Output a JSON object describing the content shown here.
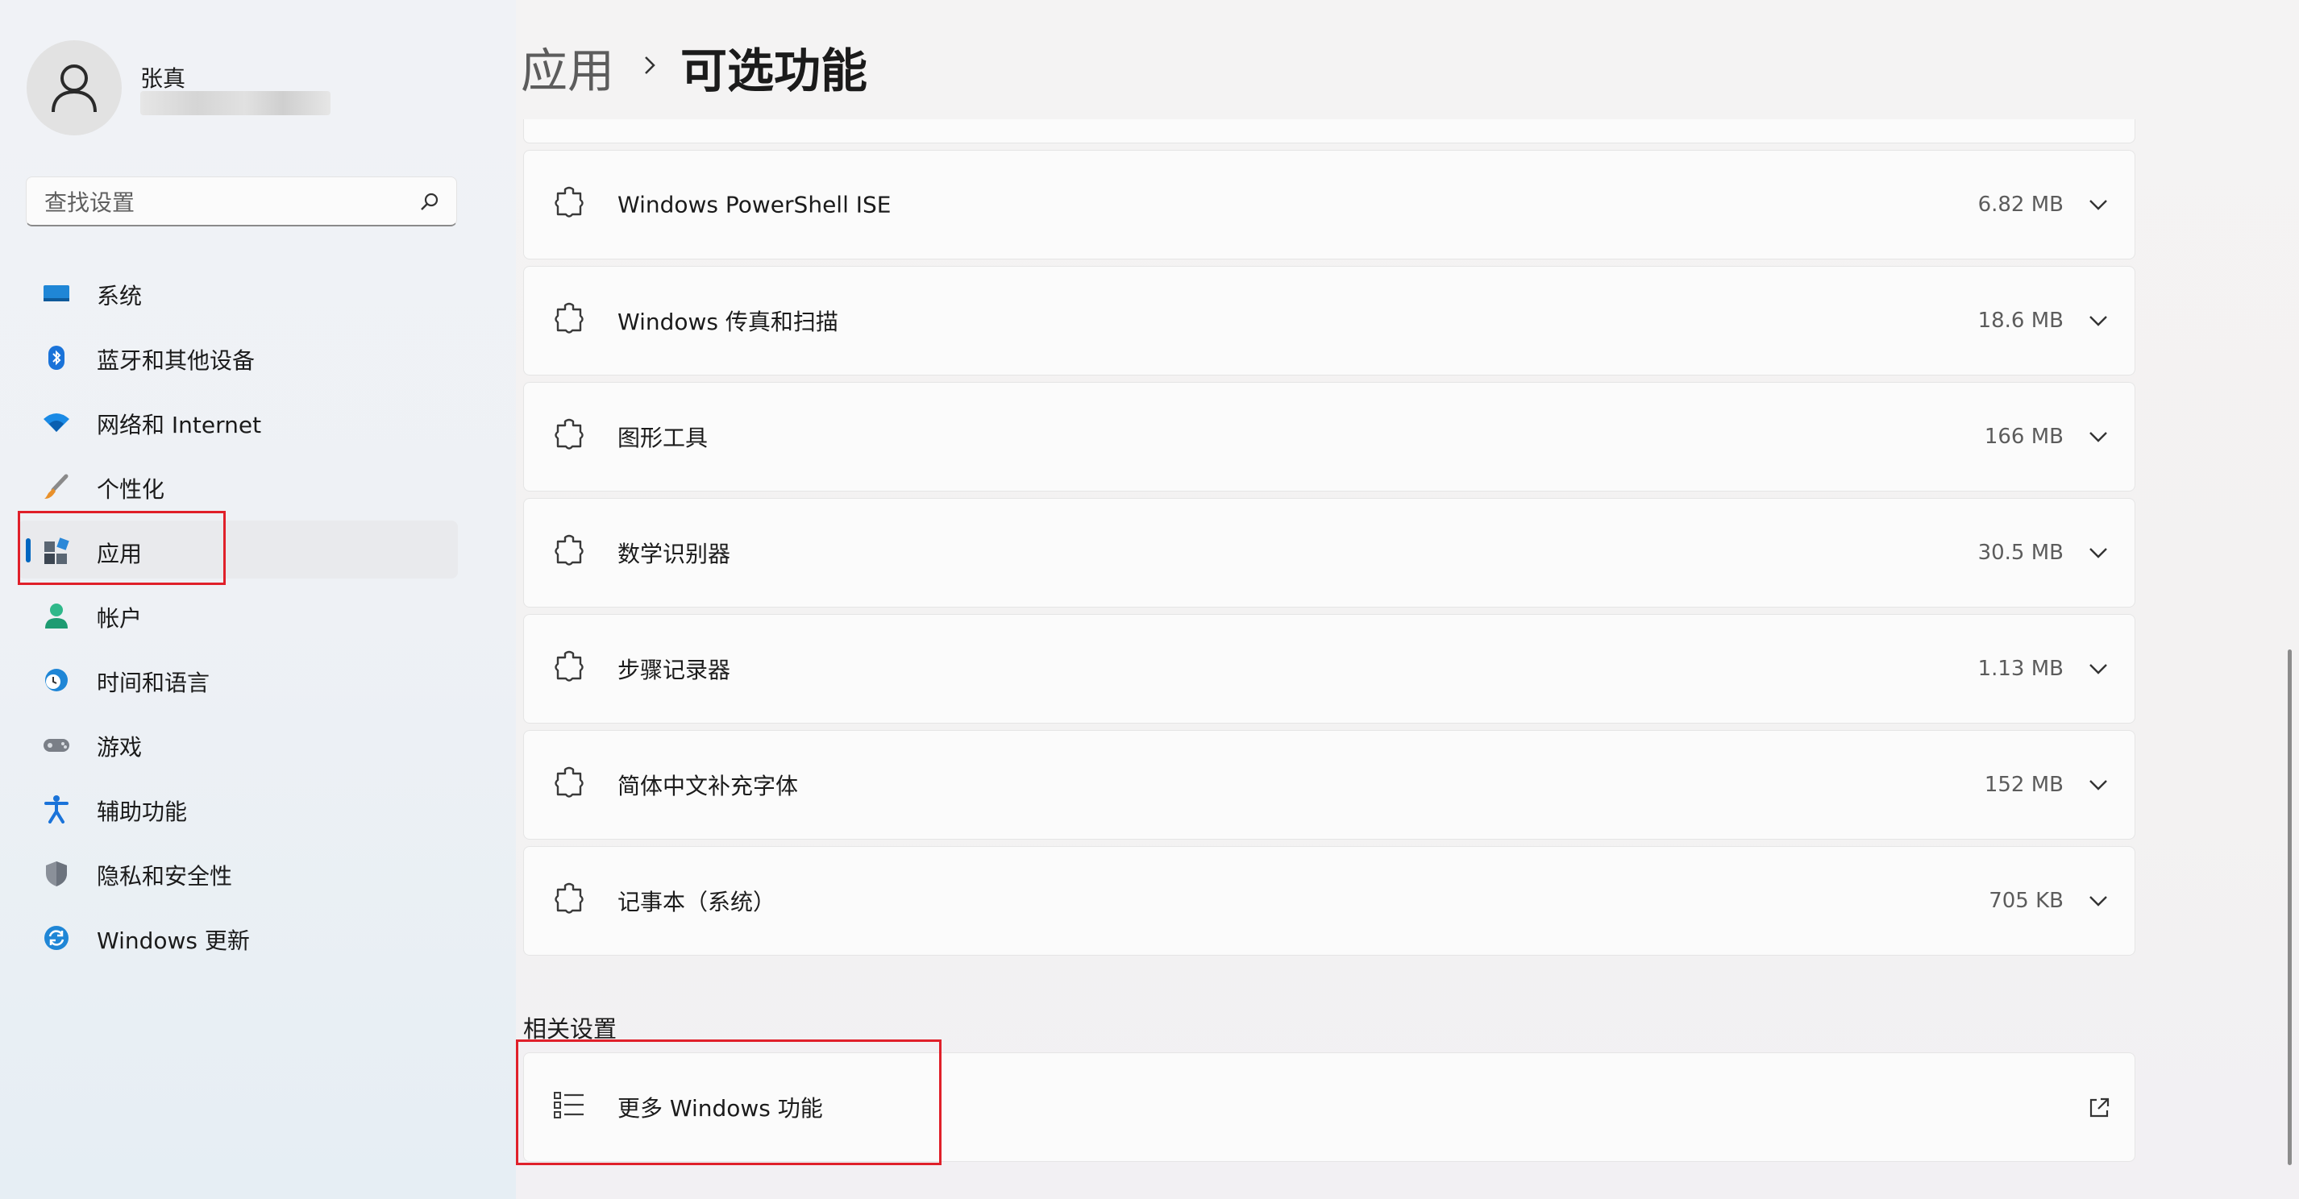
{
  "user": {
    "name": "张真"
  },
  "search": {
    "placeholder": "查找设置"
  },
  "sidebar": {
    "items": [
      {
        "label": "系统",
        "icon": "monitor-icon"
      },
      {
        "label": "蓝牙和其他设备",
        "icon": "bluetooth-icon"
      },
      {
        "label": "网络和 Internet",
        "icon": "wifi-icon"
      },
      {
        "label": "个性化",
        "icon": "brush-icon"
      },
      {
        "label": "应用",
        "icon": "apps-icon",
        "active": true
      },
      {
        "label": "帐户",
        "icon": "account-icon"
      },
      {
        "label": "时间和语言",
        "icon": "clock-globe-icon"
      },
      {
        "label": "游戏",
        "icon": "gamepad-icon"
      },
      {
        "label": "辅助功能",
        "icon": "accessibility-icon"
      },
      {
        "label": "隐私和安全性",
        "icon": "shield-icon"
      },
      {
        "label": "Windows 更新",
        "icon": "sync-icon"
      }
    ]
  },
  "breadcrumb": {
    "parent": "应用",
    "current": "可选功能"
  },
  "features": [
    {
      "name": "Windows PowerShell ISE",
      "size": "6.82 MB"
    },
    {
      "name": "Windows 传真和扫描",
      "size": "18.6 MB"
    },
    {
      "name": "图形工具",
      "size": "166 MB"
    },
    {
      "name": "数学识别器",
      "size": "30.5 MB"
    },
    {
      "name": "步骤记录器",
      "size": "1.13 MB"
    },
    {
      "name": "简体中文补充字体",
      "size": "152 MB"
    },
    {
      "name": "记事本（系统）",
      "size": "705 KB"
    }
  ],
  "related": {
    "title": "相关设置",
    "more_features": "更多 Windows 功能"
  },
  "colors": {
    "accent": "#0067c0",
    "highlight_box": "#e0202a"
  }
}
